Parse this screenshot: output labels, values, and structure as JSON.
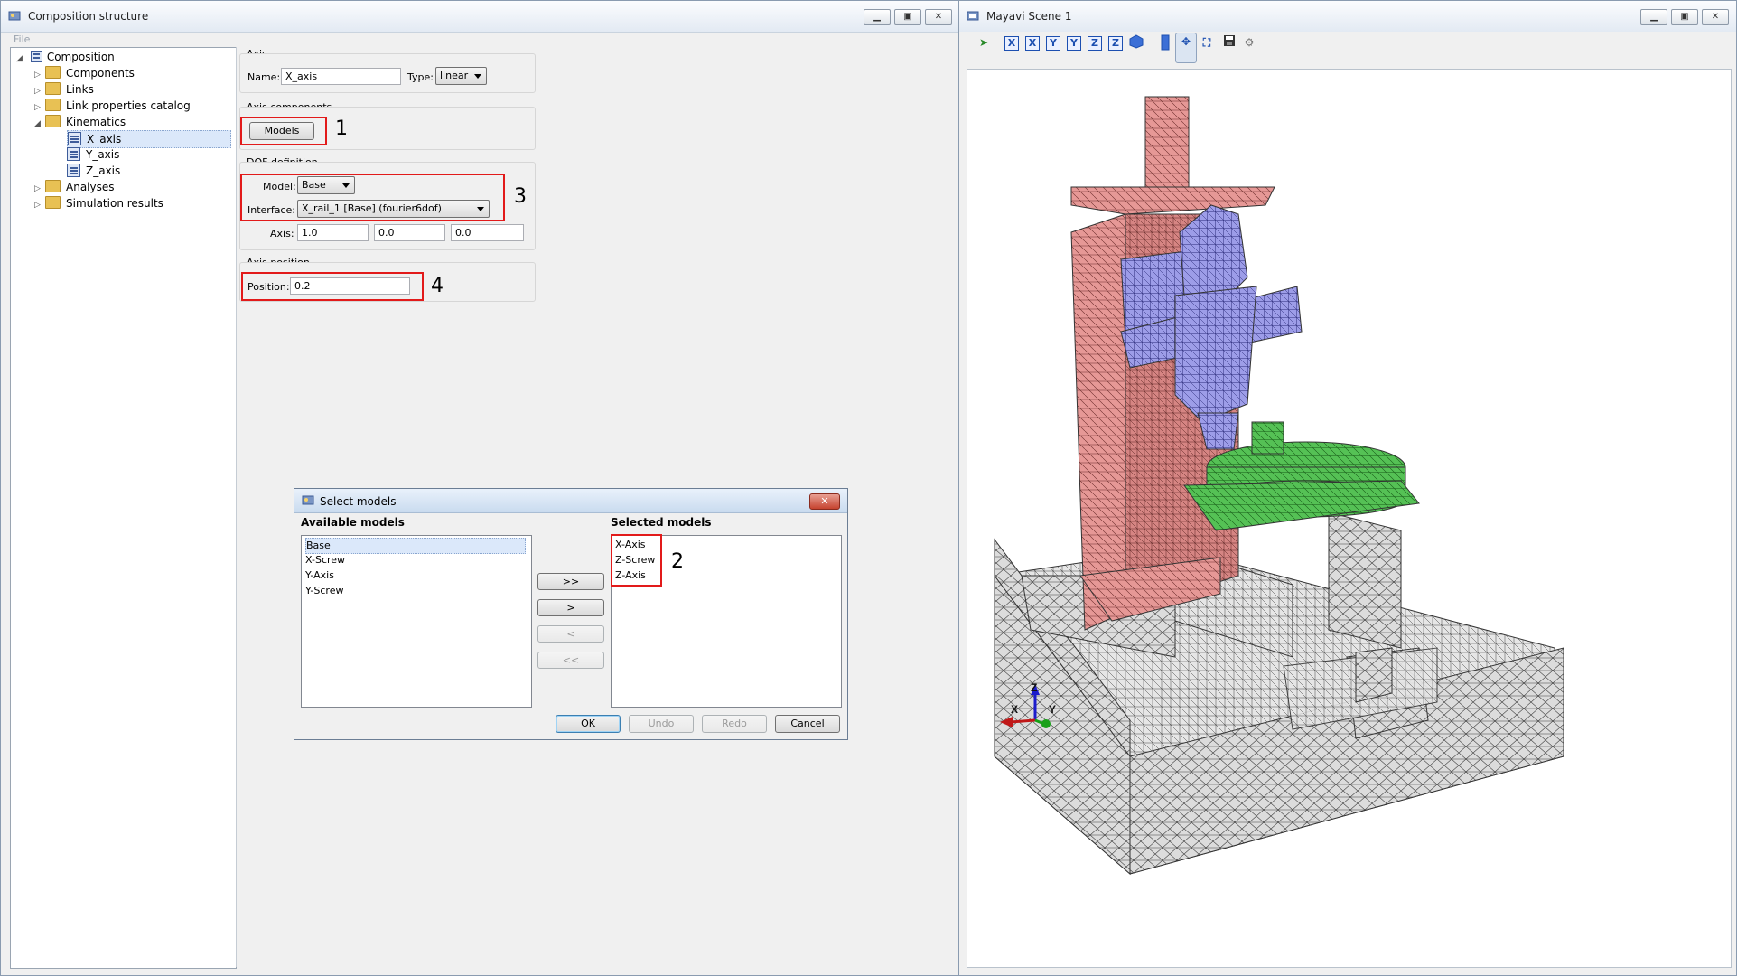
{
  "left_window": {
    "title": "Composition structure",
    "menu": "File",
    "tree": {
      "root": "Composition",
      "items": [
        "Components",
        "Links",
        "Link properties catalog",
        "Kinematics",
        "X_axis",
        "Y_axis",
        "Z_axis",
        "Analyses",
        "Simulation results"
      ]
    },
    "axis_group": {
      "title": "Axis",
      "name_label": "Name:",
      "name_value": "X_axis",
      "type_label": "Type:",
      "type_value": "linear"
    },
    "components_group": {
      "title": "Axis components",
      "models_button": "Models",
      "annotation": "1"
    },
    "dof_group": {
      "title": "DOF definition",
      "model_label": "Model:",
      "model_value": "Base",
      "interface_label": "Interface:",
      "interface_value": "X_rail_1 [Base] (fourier6dof)",
      "axis_label": "Axis:",
      "axis_values": [
        "1.0",
        "0.0",
        "0.0"
      ],
      "annotation": "3"
    },
    "position_group": {
      "title": "Axis position",
      "position_label": "Position:",
      "position_value": "0.2",
      "annotation": "4"
    }
  },
  "dialog": {
    "title": "Select models",
    "available_title": "Available models",
    "available": [
      "Base",
      "X-Screw",
      "Y-Axis",
      "Y-Screw"
    ],
    "selected_title": "Selected models",
    "selected": [
      "X-Axis",
      "Z-Screw",
      "Z-Axis"
    ],
    "annotation": "2",
    "move_buttons": [
      ">>",
      ">",
      "<",
      "<<"
    ],
    "ok": "OK",
    "undo": "Undo",
    "redo": "Redo",
    "cancel": "Cancel"
  },
  "right_window": {
    "title": "Mayavi Scene 1",
    "toolbar_icons": [
      "run-icon",
      "view-x-icon",
      "view-x-neg-icon",
      "view-y-icon",
      "view-y-neg-icon",
      "view-z-icon",
      "view-z-neg-icon",
      "isometric-icon",
      "parallel-projection-icon",
      "interaction-icon",
      "fullscreen-icon",
      "save-icon",
      "settings-icon"
    ],
    "toolbar_labels": [
      "X",
      "X",
      "Y",
      "Y",
      "Z",
      "Z"
    ],
    "axes_labels": {
      "x": "X",
      "y": "Y",
      "z": "Z"
    },
    "colors": {
      "column": "#e69896",
      "spindle": "#9b9be6",
      "table": "#55c155",
      "base": "#d9d9d9",
      "mesh": "#333333"
    }
  }
}
